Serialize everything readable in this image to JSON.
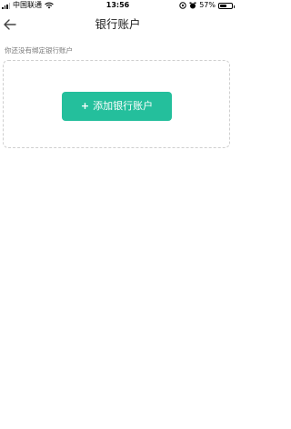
{
  "status_bar": {
    "carrier": "中国联通",
    "time": "13:56",
    "battery_percent": "57%",
    "battery_level": 0.57
  },
  "nav": {
    "title": "银行账户",
    "back_icon": "arrow-left-icon"
  },
  "main": {
    "hint_text": "你还没有绑定银行账户",
    "add_button": {
      "icon": "+",
      "label": "添加银行账户",
      "color": "#24bf9c"
    }
  }
}
